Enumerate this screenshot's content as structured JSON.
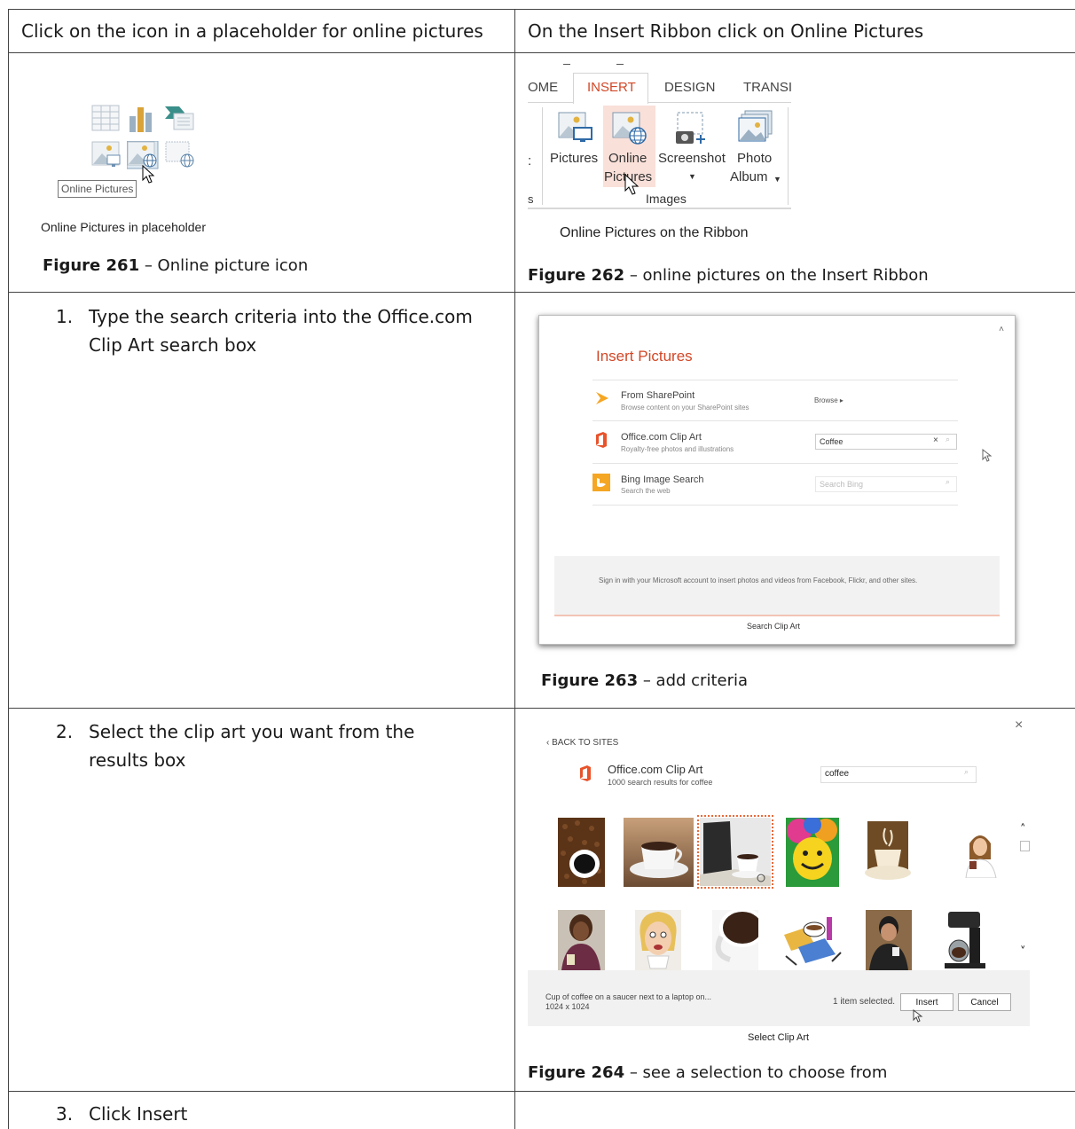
{
  "header": {
    "left": "Click on the icon in a placeholder for online pictures",
    "right": "On the Insert Ribbon click on Online Pictures"
  },
  "fig261": {
    "tooltip": "Online Pictures",
    "screenshot_caption": "Online Pictures in placeholder",
    "label": "Figure 261",
    "text": " – Online picture icon"
  },
  "fig262": {
    "tabs": [
      "OME",
      "INSERT",
      "DESIGN",
      "TRANSI"
    ],
    "buttons": {
      "pictures": "Pictures",
      "online_line1": "Online",
      "online_line2": "Pictures",
      "screenshot": "Screenshot",
      "photo_line1": "Photo",
      "photo_line2": "Album"
    },
    "group_label": "Images",
    "left_group_fragment": "s",
    "screenshot_caption": "Online Pictures on the Ribbon",
    "label": "Figure 262",
    "text": " – online pictures on the Insert Ribbon"
  },
  "step1": {
    "num": "1.",
    "text": "Type the search criteria into the Office.com Clip Art search box"
  },
  "fig263": {
    "dialog_title": "Insert Pictures",
    "sources": [
      {
        "name": "From SharePoint",
        "sub": "Browse content on your SharePoint sites",
        "action": "Browse ▸"
      },
      {
        "name": "Office.com Clip Art",
        "sub": "Royalty-free photos and illustrations",
        "input": "Coffee"
      },
      {
        "name": "Bing Image Search",
        "sub": "Search the web",
        "placeholder": "Search Bing"
      }
    ],
    "signin": "Sign in with your Microsoft account to insert photos and videos from Facebook, Flickr, and other sites.",
    "screenshot_caption": "Search Clip Art",
    "label": "Figure 263",
    "text": " – add criteria"
  },
  "step2": {
    "num": "2.",
    "text": "Select the clip art you want from the results box"
  },
  "fig264": {
    "back": "‹ BACK TO SITES",
    "source_name": "Office.com Clip Art",
    "result_count": "1000 search results for coffee",
    "search_value": "coffee",
    "selected_desc": "Cup of coffee on a saucer next to a laptop on...",
    "selected_size": "1024 x 1024",
    "selected_count": "1 item selected.",
    "insert": "Insert",
    "cancel": "Cancel",
    "screenshot_caption": "Select Clip Art",
    "label": "Figure 264",
    "text": " – see a selection to choose from"
  },
  "step3": {
    "num": "3.",
    "text": "Click Insert"
  },
  "colors": {
    "accent": "#d24726",
    "office_orange": "#e8532b",
    "bing_orange": "#f5a623",
    "selection": "#e86a3a"
  }
}
